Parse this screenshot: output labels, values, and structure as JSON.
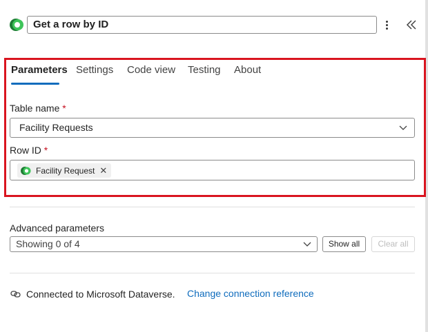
{
  "header": {
    "action_title": "Get a row by ID",
    "logo_icon": "dataverse-logo-icon",
    "more_icon": "more-vertical-icon",
    "collapse_icon": "double-chevron-left-icon"
  },
  "tabs": [
    {
      "label": "Parameters",
      "active": true
    },
    {
      "label": "Settings",
      "active": false
    },
    {
      "label": "Code view",
      "active": false
    },
    {
      "label": "Testing",
      "active": false
    },
    {
      "label": "About",
      "active": false
    }
  ],
  "fields": {
    "table_name": {
      "label": "Table name",
      "required_mark": "*",
      "value": "Facility Requests"
    },
    "row_id": {
      "label": "Row ID",
      "required_mark": "*",
      "token_label": "Facility Request",
      "token_remove": "✕"
    }
  },
  "advanced": {
    "label": "Advanced parameters",
    "value": "Showing 0 of 4",
    "show_all": "Show all",
    "clear_all": "Clear all"
  },
  "connection": {
    "status_text": "Connected to Microsoft Dataverse.",
    "change_link": "Change connection reference"
  },
  "colors": {
    "accent": "#0f6cbd",
    "highlight_border": "#d9141f",
    "required": "#c50f1f",
    "dataverse_green": "#3a9b3a"
  }
}
